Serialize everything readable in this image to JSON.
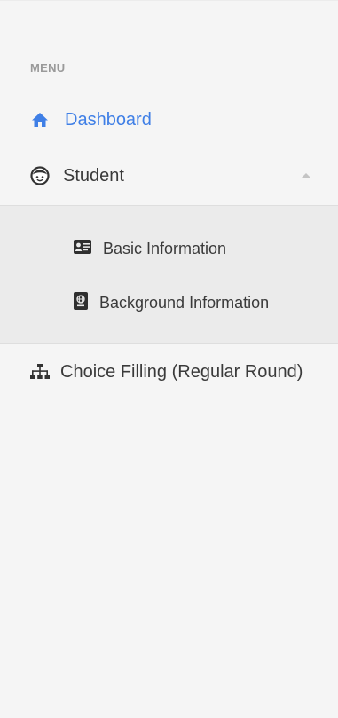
{
  "menu": {
    "heading": "MENU",
    "items": [
      {
        "label": "Dashboard",
        "icon": "home-icon",
        "active": true,
        "accent": "#3f7fe6"
      },
      {
        "label": "Student",
        "icon": "face-icon",
        "expanded": true,
        "children": [
          {
            "label": "Basic Information",
            "icon": "id-card-icon"
          },
          {
            "label": "Background Information",
            "icon": "passport-icon"
          }
        ]
      },
      {
        "label": "Choice Filling (Regular Round)",
        "icon": "sitemap-icon"
      }
    ]
  }
}
